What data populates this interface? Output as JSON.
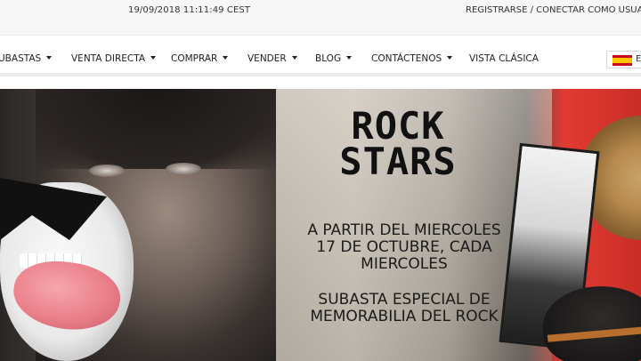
{
  "header": {
    "datetime": "19/09/2018 11:11:49 CEST",
    "register": "REGISTRARSE",
    "separator": " / ",
    "login": "CONECTAR COMO USUARIO"
  },
  "nav": {
    "items": [
      {
        "label": "UBASTAS",
        "has_dropdown": true
      },
      {
        "label": "VENTA DIRECTA",
        "has_dropdown": true
      },
      {
        "label": "COMPRAR",
        "has_dropdown": true
      },
      {
        "label": "VENDER",
        "has_dropdown": true
      },
      {
        "label": "BLOG",
        "has_dropdown": true
      },
      {
        "label": "CONTÁCTENOS",
        "has_dropdown": true
      },
      {
        "label": "VISTA CLÁSICA",
        "has_dropdown": false
      }
    ],
    "language": {
      "flag": "spain-flag-icon",
      "label": "E"
    }
  },
  "banner": {
    "title_line1": "ROCK",
    "title_line2": "STARS",
    "subtitle": "A PARTIR DEL MIERCOLES 17 DE OCTUBRE, CADA MIERCOLES",
    "subtitle2": "SUBASTA ESPECIAL DE MEMORABILIA DEL ROCK"
  }
}
